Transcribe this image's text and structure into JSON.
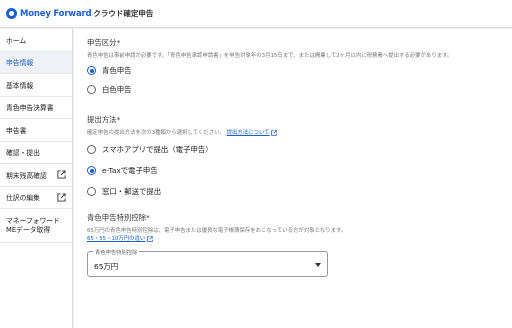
{
  "header": {
    "brand": "Money Forward",
    "product": "クラウド確定申告"
  },
  "sidebar": {
    "items": [
      {
        "label": "ホーム"
      },
      {
        "label": "申告情報"
      },
      {
        "label": "基本情報"
      },
      {
        "label": "青色申告決算書"
      },
      {
        "label": "申告書"
      },
      {
        "label": "確認・提出"
      },
      {
        "label": "期末残高確認"
      },
      {
        "label": "仕訳の編集"
      },
      {
        "label": "マネーフォワード"
      },
      {
        "label": "MEデータ取得"
      }
    ]
  },
  "filing_type": {
    "title": "申告区分*",
    "desc": "青色申告は事前申請が必要です。「青色申告承認申請書」を申告対象年の3月15日まで、または開業して2ヶ月以内に税務署へ提出する必要があります。",
    "options": [
      "青色申告",
      "白色申告"
    ],
    "selected": "青色申告"
  },
  "submission": {
    "title": "提出方法*",
    "desc": "確定申告の提出方法を次の3種類から選択してください。",
    "link": "提出方法について",
    "options": [
      "スマホアプリで提出（電子申告）",
      "e-Taxで電子申告",
      "窓口・郵送で提出"
    ],
    "selected": "e-Taxで電子申告"
  },
  "deduction": {
    "title": "青色申告特別控除*",
    "desc": "65万円の青色申告特別控除は、電子申告または優良な電子帳簿保存をおこなっている方が対象となります。",
    "link": "65・55・10万円の違い",
    "select_label": "青色申告特別控除",
    "select_value": "65万円"
  },
  "colors": {
    "accent": "#1c5fcf"
  }
}
